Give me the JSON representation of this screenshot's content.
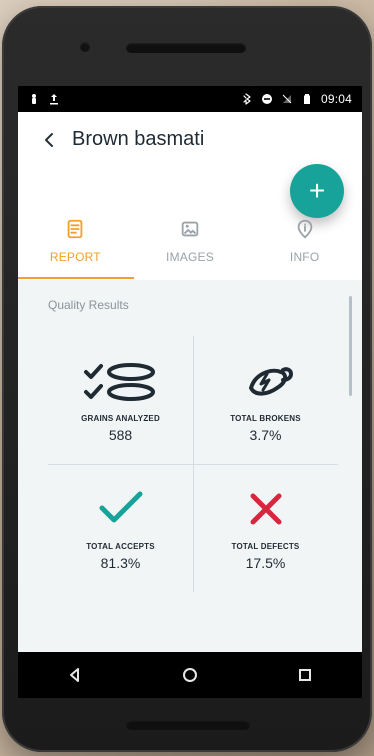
{
  "statusbar": {
    "time": "09:04"
  },
  "header": {
    "title": "Brown basmati",
    "fab_label": "+"
  },
  "tabs": [
    {
      "label": "REPORT",
      "icon": "report-icon",
      "active": true
    },
    {
      "label": "IMAGES",
      "icon": "image-icon",
      "active": false
    },
    {
      "label": "INFO",
      "icon": "info-icon",
      "active": false
    }
  ],
  "content": {
    "section_title": "Quality Results",
    "metrics": [
      {
        "label": "GRAINS ANALYZED",
        "value": "588",
        "icon": "grains-analyzed-icon"
      },
      {
        "label": "TOTAL BROKENS",
        "value": "3.7%",
        "icon": "total-brokens-icon"
      },
      {
        "label": "TOTAL ACCEPTS",
        "value": "81.3%",
        "icon": "accept-check-icon"
      },
      {
        "label": "TOTAL DEFECTS",
        "value": "17.5%",
        "icon": "defect-x-icon"
      }
    ]
  },
  "colors": {
    "accent": "#f2a02b",
    "fab": "#18a39a",
    "navy": "#1f2a33",
    "teal": "#18a39a",
    "red": "#d7263d"
  },
  "navbar": {
    "buttons": [
      "back-nav-icon",
      "home-nav-icon",
      "recents-nav-icon"
    ]
  }
}
